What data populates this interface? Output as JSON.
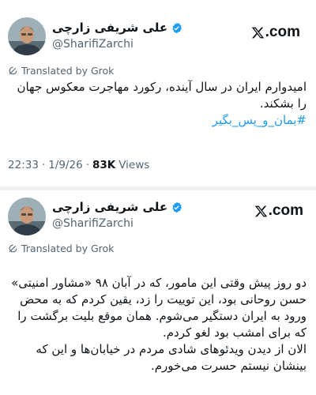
{
  "tweets": [
    {
      "author_name": "علی شریفی زارچی",
      "handle": "@SharifiZarchi",
      "brand": ".com",
      "translated_label": "Translated by Grok",
      "text": "امیدوارم ایران در سال آینده، رکورد مهاجرت معکوس جهان را بشکند.",
      "hashtag": "#بمان_و_پس_بگیر",
      "time": "22:33",
      "date": "1/9/26",
      "views_count": "83K",
      "views_label": "Views"
    },
    {
      "author_name": "علی شریفی زارچی",
      "handle": "@SharifiZarchi",
      "brand": ".com",
      "translated_label": "Translated by Grok",
      "text": "دو روز پیش وقتی این مامور، که در آبان ۹۸ «مشاور امنیتی» حسن روحانی بود، این توییت را زد، یقین کردم که به محض ورود به ایران دستگیر می‌شوم. همان موقع بلیت برگشت را که برای امشب بود لغو کردم.\nالان از دیدن ویدئوهای شادی مردم در خیابان‌ها و این که بینشان نیستم حسرت می‌خورم."
    }
  ],
  "colors": {
    "accent": "#1d9bf0",
    "muted": "#536471",
    "text": "#0f1419"
  }
}
